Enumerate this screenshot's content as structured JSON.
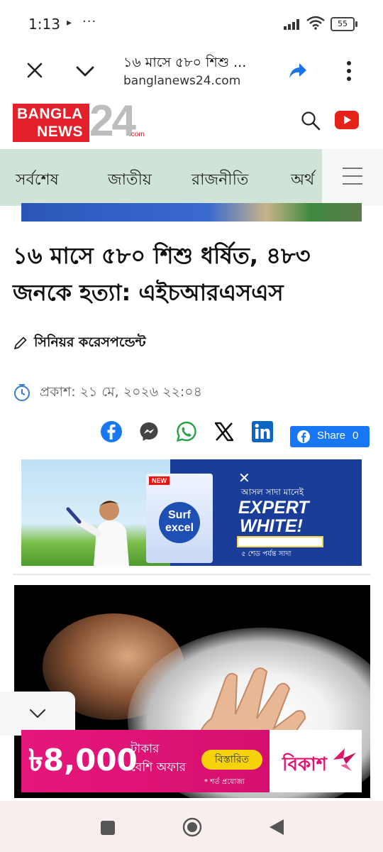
{
  "status_bar": {
    "time": "1:13",
    "cast_glyph": "▸",
    "dots": "···",
    "battery": "55"
  },
  "browser": {
    "page_title": "১৬ মাসে ৫৮০ শিশু ...",
    "url": "banglanews24.com",
    "icons": [
      "close-icon",
      "chevron-down-icon",
      "share-icon",
      "more-vert-icon"
    ]
  },
  "site": {
    "logo_line1": "BANGLA",
    "logo_line2": "NEWS",
    "logo_number": "24",
    "logo_domain": ".com",
    "brand_red": "#e4202a",
    "youtube_red": "#e62117"
  },
  "nav": {
    "items": [
      "সর্বশেষ",
      "জাতীয়",
      "রাজনীতি",
      "অর্থ"
    ],
    "background": "#cfe3d7"
  },
  "article": {
    "headline": "১৬ মাসে ৫৮০ শিশু ধর্ষিত, ৪৮৩ জনকে হত্যা: এইচআরএসএস",
    "author": "সিনিয়র করেসপন্ডেন্ট",
    "published": "প্রকাশ: ২১ মে, ২০২৬ ২২:০৪"
  },
  "share": {
    "networks": [
      "facebook",
      "messenger",
      "whatsapp",
      "x",
      "linkedin"
    ],
    "fb_button_label": "Share",
    "fb_count": "0"
  },
  "ad_surf": {
    "new_badge": "NEW",
    "brand": "Surf excel",
    "line1": "আসল সাদা মানেই",
    "headline1": "EXPERT",
    "headline2": "WHITE!",
    "line2": "৫ শেড পর্যন্ত সাদা"
  },
  "ad_bkash": {
    "amount": "৳8,000",
    "line1": "টাকার",
    "line2": "বেশি অফার",
    "button": "বিস্তারিত",
    "terms": "* শর্ত প্রযোজ্য",
    "brand": "বিকাশ",
    "accent": "#e2136e"
  }
}
